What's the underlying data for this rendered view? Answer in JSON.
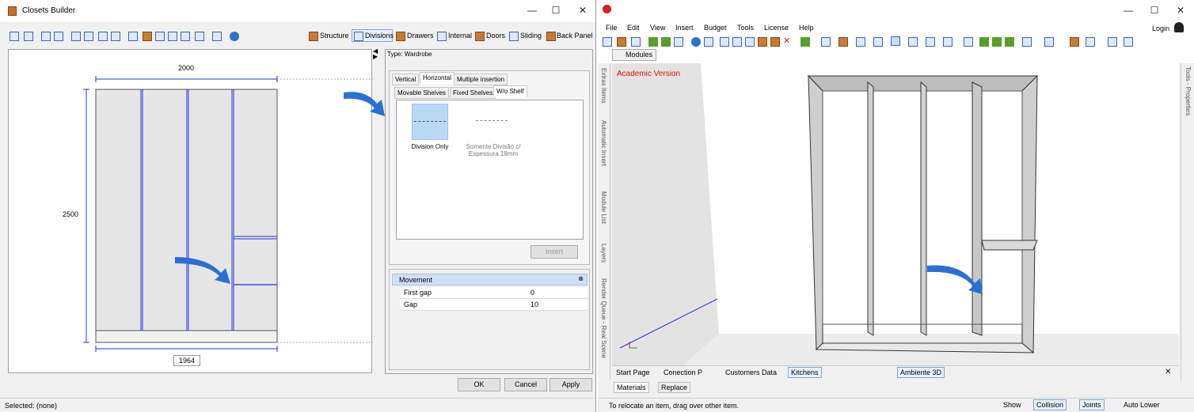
{
  "left_window": {
    "title": "Closets Builder",
    "controls": {
      "minimize": "—",
      "maximize": "☐",
      "close": "✕"
    },
    "toolbar_tabs": [
      "Structure",
      "Divisions",
      "Drawers",
      "Internal",
      "Doors",
      "Sliding",
      "Back Panel"
    ],
    "drawing": {
      "width_label": "2000",
      "height_label": "2500",
      "inner_width_label": "1964"
    },
    "type_label": "Type: Wardrobe",
    "tabs_row1": [
      "Vertical",
      "Horizontal",
      "Multiple insertion"
    ],
    "tabs_row2": [
      "Movable Shelves",
      "Fixed Shelves",
      "W/o Shelf"
    ],
    "items": [
      {
        "label": "Division Only"
      },
      {
        "label": "Somente Divisão c/ Espessura 18mm"
      }
    ],
    "insert_button": "Insert",
    "movement": {
      "header": "Movement",
      "rows": [
        {
          "name": "First gap",
          "value": "0"
        },
        {
          "name": "Gap",
          "value": "10"
        }
      ]
    },
    "buttons": {
      "ok": "OK",
      "cancel": "Cancel",
      "apply": "Apply"
    },
    "status": "Selected: (none)"
  },
  "right_window": {
    "controls": {
      "minimize": "—",
      "maximize": "☐",
      "close": "✕"
    },
    "menu": [
      "File",
      "Edit",
      "View",
      "Insert",
      "Budget",
      "Tools",
      "License",
      "Help"
    ],
    "login": "Login",
    "modules_tab": "Modules",
    "watermark": "Academic Version",
    "side_tabs_left": [
      "Extras Items",
      "Automatic Insert",
      "Module List",
      "Layers",
      "Render Queue - Real Scene"
    ],
    "side_tab_right": "Tools - Properties",
    "bottom_tabs": [
      "Start Page",
      "Conection P",
      "Customers Data",
      "Kitchens"
    ],
    "ambient_tab": "Ambiente 3D",
    "close_x": "✕",
    "subtabs": [
      "Materials",
      "Replace"
    ],
    "status": "To relocate an item, drag over other item.",
    "status_right": {
      "show": "Show",
      "collision": "Collision",
      "joints": "Joints",
      "auto_lower": "Auto Lower"
    }
  },
  "colors": {
    "accent_blue": "#2a6fd6",
    "drawing_line": "#1f35d8",
    "watermark_red": "#e01010"
  }
}
